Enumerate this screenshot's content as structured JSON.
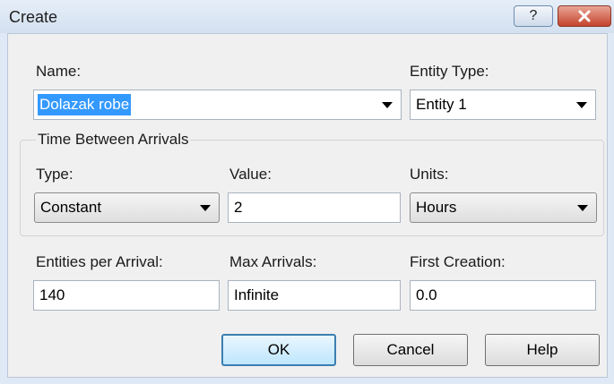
{
  "window": {
    "title": "Create",
    "help_glyph": "?"
  },
  "form": {
    "name_label": "Name:",
    "name_value": "Dolazak robe",
    "entity_type_label": "Entity Type:",
    "entity_type_value": "Entity 1",
    "group_title": "Time Between Arrivals",
    "type_label": "Type:",
    "type_value": "Constant",
    "value_label": "Value:",
    "value_value": "2",
    "units_label": "Units:",
    "units_value": "Hours",
    "entities_label": "Entities per Arrival:",
    "entities_value": "140",
    "max_label": "Max Arrivals:",
    "max_value": "Infinite",
    "first_label": "First Creation:",
    "first_value": "0.0"
  },
  "buttons": {
    "ok": "OK",
    "cancel": "Cancel",
    "help": "Help"
  },
  "icons": {
    "help": "help-icon",
    "close": "close-icon",
    "dropdown": "chevron-down-icon"
  },
  "colors": {
    "selection": "#3399ff",
    "close_button": "#c5432d",
    "default_button_border": "#3c7fb1"
  }
}
